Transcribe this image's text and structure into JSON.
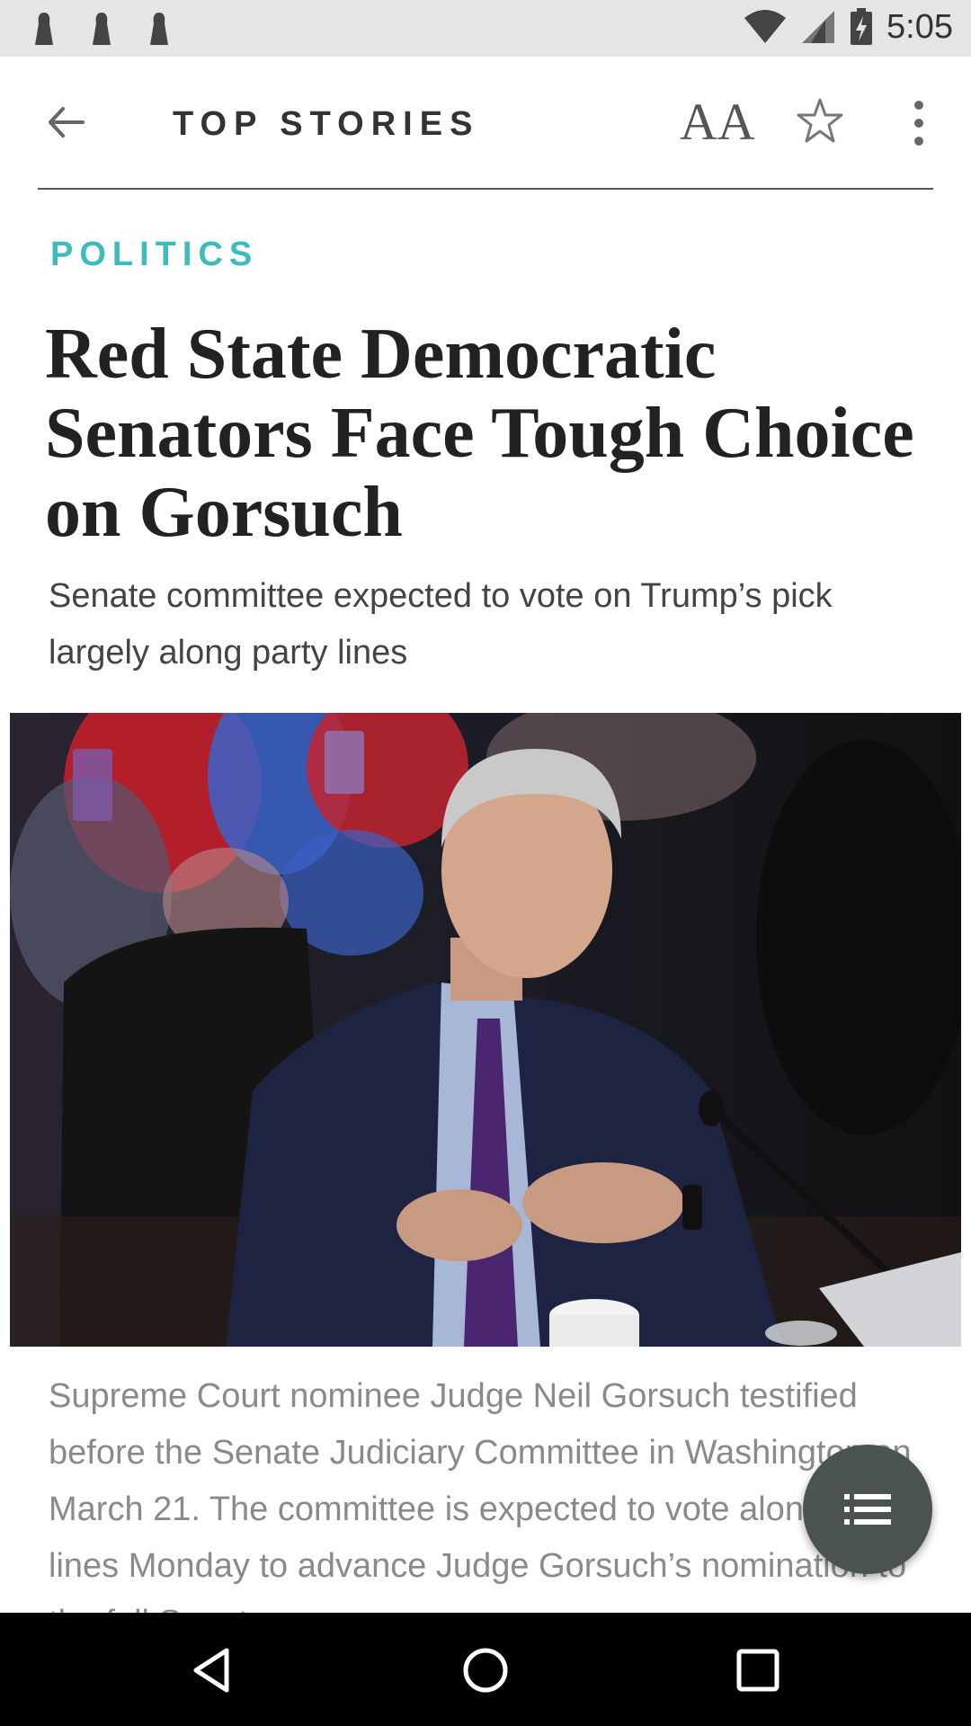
{
  "status_bar": {
    "time": "5:05",
    "icons": [
      "notification-icon",
      "notification-icon",
      "notification-icon",
      "wifi-icon",
      "cell-signal-icon",
      "battery-charging-icon"
    ]
  },
  "app_bar": {
    "title": "TOP STORIES",
    "font_size_label": "AA",
    "icons": [
      "back-arrow-icon",
      "font-size-icon",
      "star-icon",
      "more-vert-icon"
    ]
  },
  "article": {
    "kicker": "POLITICS",
    "headline": "Red State Democratic Senators Face Tough Choice on Gorsuch",
    "dek": "Senate committee expected to vote on Trump’s pick largely along party lines",
    "caption": "Supreme Court nominee Judge Neil Gorsuch testified before the Senate Judiciary Committee in Washington on March 21. The committee is expected to vote along party lines Monday to advance Judge Gorsuch’s nomination to the full Senate."
  },
  "fab": {
    "icon": "list-icon"
  },
  "nav_bar": {
    "icons": [
      "back-triangle-icon",
      "home-circle-icon",
      "recents-square-icon"
    ]
  },
  "colors": {
    "accent": "#3dbcc0",
    "status_bar_bg": "#e3e6e3",
    "fab_bg": "#4a5350"
  }
}
